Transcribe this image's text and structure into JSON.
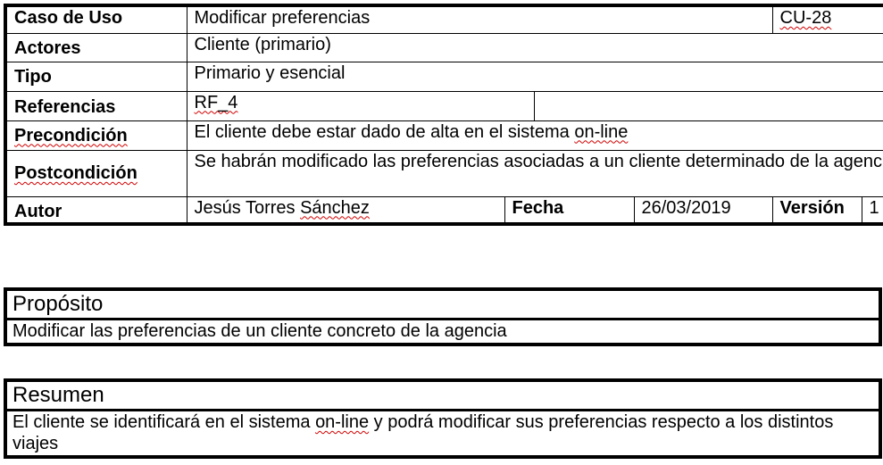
{
  "use_case": {
    "label_caso": "Caso de Uso",
    "nombre": "Modificar preferencias",
    "codigo": "CU-28",
    "label_actores": "Actores",
    "actores": "Cliente (primario)",
    "label_tipo": "Tipo",
    "tipo": "Primario y esencial",
    "label_referencias": "Referencias",
    "referencias": "RF_4",
    "label_precondicion": "Precondición",
    "precondicion_pre": "El cliente debe estar dado de alta en el sistema ",
    "precondicion_term": "on-line",
    "label_postcondicion": "Postcondición",
    "postcondicion": "Se habrán modificado las preferencias asociadas a un cliente determinado de la agencia",
    "label_autor": "Autor",
    "autor_pre": "Jesús Torres ",
    "autor_apellido": "Sánchez",
    "label_fecha": "Fecha",
    "fecha": "26/03/2019",
    "label_version": "Versión",
    "version": "1"
  },
  "proposito": {
    "titulo": "Propósito",
    "texto": "Modificar las preferencias de un cliente concreto de la agencia"
  },
  "resumen": {
    "titulo": "Resumen",
    "texto_pre": "El cliente se identificará en el sistema ",
    "texto_term": "on-line",
    "texto_post": " y podrá modificar sus preferencias respecto a los distintos viajes"
  }
}
